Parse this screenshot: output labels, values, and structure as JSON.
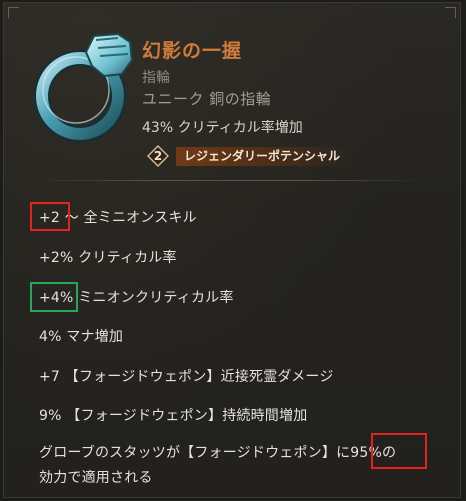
{
  "item": {
    "name": "幻影の一握",
    "type": "指輪",
    "rarity": "ユニーク 銅の指輪",
    "implicit": "43% クリティカル率増加",
    "legendary_potential": {
      "number": "2",
      "label": "レジェンダリーポテンシャル"
    }
  },
  "affixes": [
    {
      "value": "+2",
      "text": " ～ 全ミニオンスキル"
    },
    {
      "value": "+2%",
      "text": " クリティカル率"
    },
    {
      "value": "+4%",
      "text": " ミニオンクリティカル率"
    },
    {
      "value": "4%",
      "text": " マナ増加"
    },
    {
      "value": "+7",
      "text": " 【フォージドウェポン】近接死霊ダメージ"
    },
    {
      "value": "9%",
      "text": " 【フォージドウェポン】持続時間増加"
    },
    {
      "line1_prefix": "グローブのスタッツが【フォージドウェポン】に",
      "value": "95%",
      "line1_suffix": "の",
      "line2": "効力で適用される"
    }
  ],
  "colors": {
    "title": "#d17b3a",
    "highlight_red": "#e4221e",
    "highlight_green": "#27a857"
  },
  "icons": {
    "item": "ring-icon",
    "legendary": "diamond-badge-icon"
  }
}
